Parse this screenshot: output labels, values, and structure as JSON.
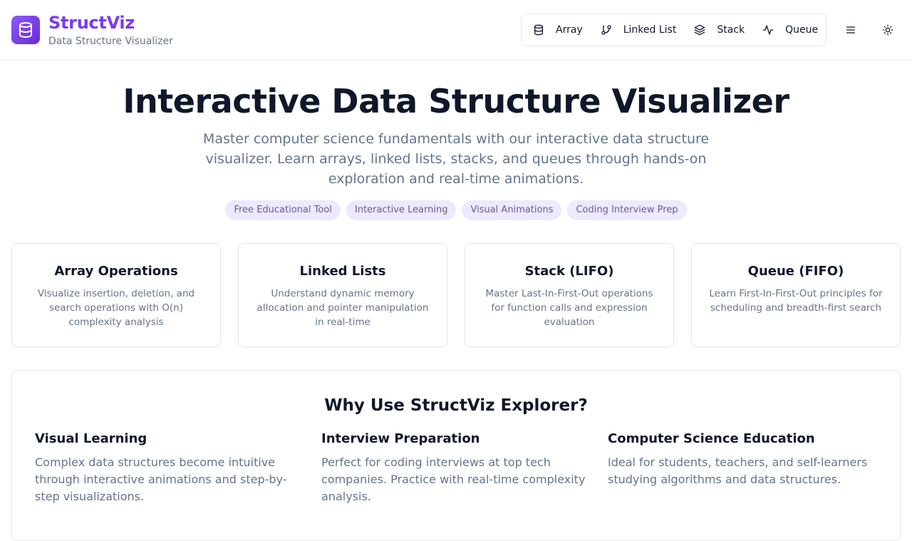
{
  "brand": {
    "name": "StructViz",
    "subtitle": "Data Structure Visualizer",
    "logo_icon": "database-icon",
    "accent": "#7c3aed"
  },
  "nav": {
    "items": [
      {
        "label": "Array",
        "icon": "database-icon"
      },
      {
        "label": "Linked List",
        "icon": "git-branch-icon"
      },
      {
        "label": "Stack",
        "icon": "layers-icon"
      },
      {
        "label": "Queue",
        "icon": "activity-icon"
      }
    ],
    "menu_icon": "menu-icon",
    "theme_icon": "sun-icon"
  },
  "hero": {
    "title": "Interactive Data Structure Visualizer",
    "description": "Master computer science fundamentals with our interactive data structure visualizer. Learn arrays, linked lists, stacks, and queues through hands-on exploration and real-time animations.",
    "tags": [
      "Free Educational Tool",
      "Interactive Learning",
      "Visual Animations",
      "Coding Interview Prep"
    ]
  },
  "cards": [
    {
      "title": "Array Operations",
      "description": "Visualize insertion, deletion, and search operations with O(n) complexity analysis"
    },
    {
      "title": "Linked Lists",
      "description": "Understand dynamic memory allocation and pointer manipulation in real-time"
    },
    {
      "title": "Stack (LIFO)",
      "description": "Master Last-In-First-Out operations for function calls and expression evaluation"
    },
    {
      "title": "Queue (FIFO)",
      "description": "Learn First-In-First-Out principles for scheduling and breadth-first search"
    }
  ],
  "why": {
    "title": "Why Use StructViz Explorer?",
    "columns": [
      {
        "title": "Visual Learning",
        "description": "Complex data structures become intuitive through interactive animations and step-by-step visualizations."
      },
      {
        "title": "Interview Preparation",
        "description": "Perfect for coding interviews at top tech companies. Practice with real-time complexity analysis."
      },
      {
        "title": "Computer Science Education",
        "description": "Ideal for students, teachers, and self-learners studying algorithms and data structures."
      }
    ]
  }
}
